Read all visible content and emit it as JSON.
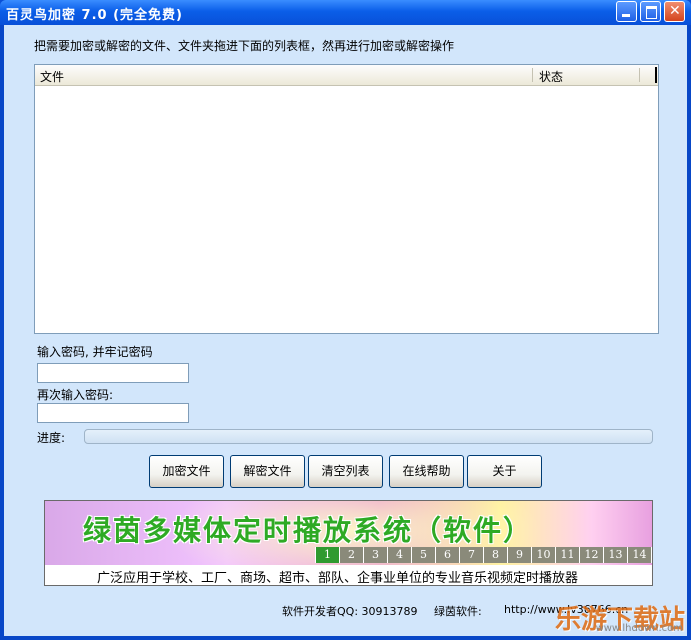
{
  "window": {
    "title": "百灵鸟加密 7.0 (完全免费)"
  },
  "instructions": "把需要加密或解密的文件、文件夹拖进下面的列表框，然再进行加密或解密操作",
  "list": {
    "columns": [
      "文件",
      "状态"
    ]
  },
  "password": {
    "label": "输入密码, 并牢记密码",
    "value": ""
  },
  "confirm_password": {
    "label": "再次输入密码:",
    "value": ""
  },
  "progress": {
    "label": "进度:",
    "value": 0
  },
  "buttons": {
    "encrypt": "加密文件",
    "decrypt": "解密文件",
    "clear": "清空列表",
    "help": "在线帮助",
    "about": "关于"
  },
  "banner": {
    "title": "绿茵多媒体定时播放系统（软件）",
    "numbers": [
      "1",
      "2",
      "3",
      "4",
      "5",
      "6",
      "7",
      "8",
      "9",
      "10",
      "11",
      "12",
      "13",
      "14",
      "1"
    ],
    "subtitle": "广泛应用于学校、工厂、商场、超市、部队、企事业单位的专业音乐视频定时播放器"
  },
  "footer": {
    "developer": "软件开发者QQ: 30913789",
    "software_label": "绿茵软件:",
    "url": "http://www.lv36766.cn"
  },
  "watermark": {
    "text": "乐游下载站",
    "url": "www.lhdown.com"
  },
  "colors": {
    "titlebar": "#0b5ee8",
    "client_bg": "#d2e6fb",
    "banner_title": "#2eaa24",
    "num_strip_active": "#2f9a2f",
    "num_strip": "#8a8a7a"
  }
}
